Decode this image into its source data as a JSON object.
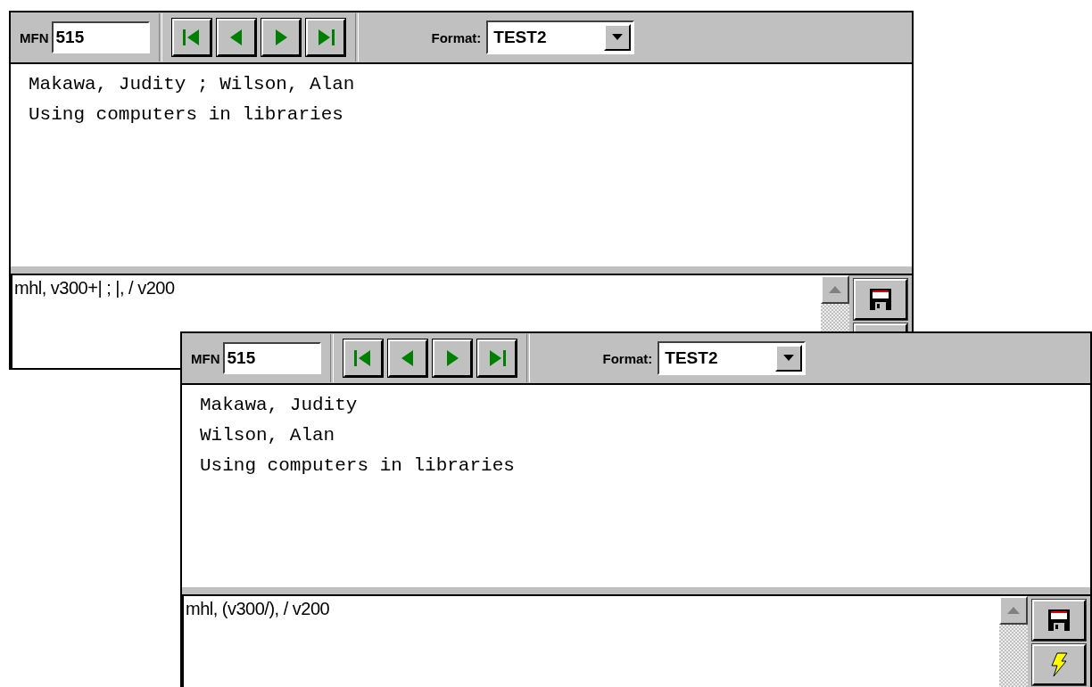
{
  "windows": [
    {
      "mfn_label": "MFN",
      "mfn": "515",
      "format_label": "Format:",
      "format": "TEST2",
      "output_lines": [
        "Makawa, Judity ; Wilson, Alan",
        "Using computers in libraries"
      ],
      "format_expression": "mhl, v300+| ; |, / v200"
    },
    {
      "mfn_label": "MFN",
      "mfn": "515",
      "format_label": "Format:",
      "format": "TEST2",
      "output_lines": [
        "Makawa, Judity",
        "Wilson, Alan",
        "Using computers in libraries"
      ],
      "format_expression": "mhl, (v300/), / v200"
    }
  ]
}
